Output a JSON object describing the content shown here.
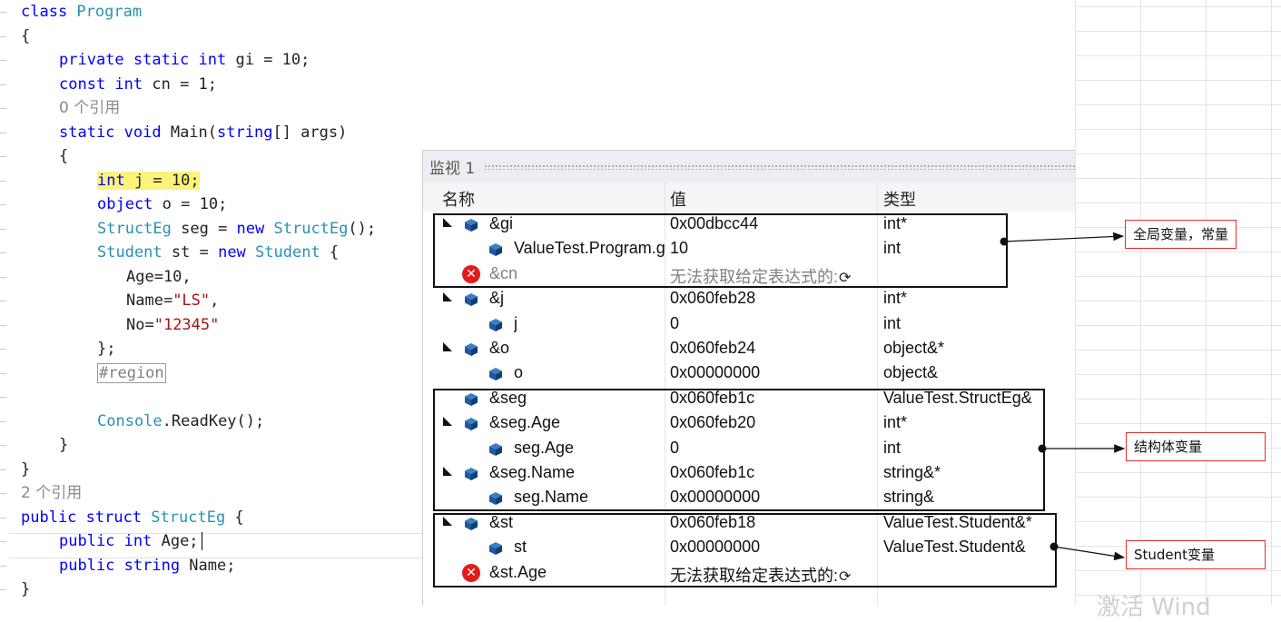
{
  "code_lines": [
    {
      "indent": 0,
      "parts": [
        {
          "t": "class ",
          "c": "kw"
        },
        {
          "t": "Program",
          "c": "ty"
        }
      ]
    },
    {
      "indent": 0,
      "parts": [
        {
          "t": "{",
          "c": ""
        }
      ]
    },
    {
      "indent": 1,
      "parts": [
        {
          "t": "private static int ",
          "c": "kw"
        },
        {
          "t": "gi = 10;",
          "c": ""
        }
      ]
    },
    {
      "indent": 1,
      "parts": [
        {
          "t": "const int ",
          "c": "kw"
        },
        {
          "t": "cn = 1;",
          "c": ""
        }
      ]
    },
    {
      "indent": 1,
      "parts": [
        {
          "t": "0 个引用",
          "c": "ref"
        }
      ]
    },
    {
      "indent": 1,
      "parts": [
        {
          "t": "static void ",
          "c": "kw"
        },
        {
          "t": "Main(",
          "c": ""
        },
        {
          "t": "string",
          "c": "kw"
        },
        {
          "t": "[] args)",
          "c": ""
        }
      ]
    },
    {
      "indent": 1,
      "parts": [
        {
          "t": "{",
          "c": ""
        }
      ]
    },
    {
      "indent": 2,
      "parts": [
        {
          "t": "int ",
          "c": "kw hl"
        },
        {
          "t": "j = 10;",
          "c": "hl"
        }
      ]
    },
    {
      "indent": 2,
      "parts": [
        {
          "t": "object ",
          "c": "kw"
        },
        {
          "t": "o = 10;",
          "c": ""
        }
      ]
    },
    {
      "indent": 2,
      "parts": [
        {
          "t": "StructEg ",
          "c": "ty"
        },
        {
          "t": "seg = ",
          "c": ""
        },
        {
          "t": "new ",
          "c": "kw"
        },
        {
          "t": "StructEg",
          "c": "ty"
        },
        {
          "t": "();",
          "c": ""
        }
      ]
    },
    {
      "indent": 2,
      "parts": [
        {
          "t": "Student ",
          "c": "ty"
        },
        {
          "t": "st = ",
          "c": ""
        },
        {
          "t": "new ",
          "c": "kw"
        },
        {
          "t": "Student",
          "c": "ty"
        },
        {
          "t": " {",
          "c": ""
        }
      ]
    },
    {
      "indent": 3,
      "parts": [
        {
          "t": "Age=10,",
          "c": ""
        }
      ]
    },
    {
      "indent": 3,
      "parts": [
        {
          "t": "Name=",
          "c": ""
        },
        {
          "t": "\"LS\"",
          "c": "str"
        },
        {
          "t": ",",
          "c": ""
        }
      ]
    },
    {
      "indent": 3,
      "parts": [
        {
          "t": "No=",
          "c": ""
        },
        {
          "t": "\"12345\"",
          "c": "str"
        }
      ]
    },
    {
      "indent": 2,
      "parts": [
        {
          "t": "};",
          "c": ""
        }
      ]
    },
    {
      "indent": 2,
      "parts": [
        {
          "t": "#region",
          "c": "region"
        }
      ]
    },
    {
      "indent": 2,
      "parts": []
    },
    {
      "indent": 2,
      "parts": [
        {
          "t": "Console",
          "c": "ty"
        },
        {
          "t": ".ReadKey();",
          "c": ""
        }
      ]
    },
    {
      "indent": 1,
      "parts": [
        {
          "t": "}",
          "c": ""
        }
      ]
    },
    {
      "indent": 0,
      "parts": [
        {
          "t": "}",
          "c": ""
        }
      ]
    },
    {
      "indent": 0,
      "parts": [
        {
          "t": "2 个引用",
          "c": "ref"
        }
      ]
    },
    {
      "indent": 0,
      "parts": [
        {
          "t": "public struct ",
          "c": "kw"
        },
        {
          "t": "StructEg",
          "c": "ty"
        },
        {
          "t": " {",
          "c": ""
        }
      ]
    },
    {
      "indent": 1,
      "parts": [
        {
          "t": "public int ",
          "c": "kw"
        },
        {
          "t": "Age;",
          "c": ""
        }
      ],
      "caret": true
    },
    {
      "indent": 1,
      "parts": [
        {
          "t": "public string ",
          "c": "kw"
        },
        {
          "t": "Name;",
          "c": ""
        }
      ]
    },
    {
      "indent": 0,
      "parts": [
        {
          "t": "}",
          "c": ""
        }
      ]
    }
  ],
  "watch": {
    "title": "监视 1",
    "columns": {
      "name": "名称",
      "value": "值",
      "type": "类型"
    },
    "rows": [
      {
        "level": 0,
        "expand": true,
        "icon": "field-cube-icon",
        "name": "&gi",
        "value": "0x00dbcc44",
        "type": "int*"
      },
      {
        "level": 1,
        "expand": false,
        "icon": "field-cube-icon",
        "name": "ValueTest.Program.gi",
        "value": "10",
        "type": "int"
      },
      {
        "level": 0,
        "expand": false,
        "icon": "error-icon",
        "name": "&cn",
        "value": "无法获取给定表达式的:",
        "type": "",
        "error": true
      },
      {
        "level": 0,
        "expand": true,
        "icon": "field-cube-icon",
        "name": "&j",
        "value": "0x060feb28",
        "type": "int*"
      },
      {
        "level": 1,
        "expand": false,
        "icon": "field-cube-icon",
        "name": "j",
        "value": "0",
        "type": "int"
      },
      {
        "level": 0,
        "expand": true,
        "icon": "field-cube-icon",
        "name": "&o",
        "value": "0x060feb24",
        "type": "object&*"
      },
      {
        "level": 1,
        "expand": false,
        "icon": "field-cube-icon",
        "name": "o",
        "value": "0x00000000",
        "type": "object&"
      },
      {
        "level": 0,
        "expand": false,
        "icon": "field-cube-icon",
        "name": "&seg",
        "value": "0x060feb1c",
        "type": "ValueTest.StructEg&"
      },
      {
        "level": 0,
        "expand": true,
        "icon": "field-cube-icon",
        "name": "&seg.Age",
        "value": "0x060feb20",
        "type": "int*"
      },
      {
        "level": 1,
        "expand": false,
        "icon": "field-cube-icon",
        "name": "seg.Age",
        "value": "0",
        "type": "int"
      },
      {
        "level": 0,
        "expand": true,
        "icon": "field-cube-icon",
        "name": "&seg.Name",
        "value": "0x060feb1c",
        "type": "string&*"
      },
      {
        "level": 1,
        "expand": false,
        "icon": "field-cube-icon",
        "name": "seg.Name",
        "value": "0x00000000",
        "type": "string&"
      },
      {
        "level": 0,
        "expand": true,
        "icon": "field-cube-icon",
        "name": "&st",
        "value": "0x060feb18",
        "type": "ValueTest.Student&*"
      },
      {
        "level": 1,
        "expand": false,
        "icon": "field-cube-icon",
        "name": "st",
        "value": "0x00000000",
        "type": "ValueTest.Student&"
      },
      {
        "level": 0,
        "expand": false,
        "icon": "error-icon",
        "name": "&st.Age",
        "value": "无法获取给定表达式的:",
        "type": "",
        "error": true
      }
    ]
  },
  "annotations": {
    "global": "全局变量，常量",
    "struct": "结构体变量",
    "student": "Student变量"
  },
  "watermark": "激活 Wind",
  "colors": {
    "keyword": "#0000ff",
    "type": "#2b91af",
    "string": "#a31515",
    "highlight": "#fbf37a",
    "error": "#e21b1b",
    "annotation_border": "#e0302c"
  }
}
